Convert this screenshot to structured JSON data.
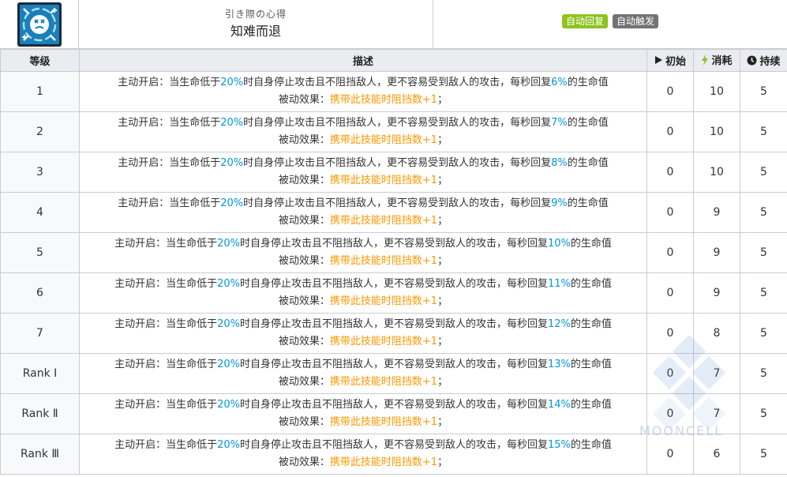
{
  "skill": {
    "name_jp": "引き際の心得",
    "name_cn": "知难而退",
    "icon": "skill-icon-broken-shield",
    "tags": [
      {
        "label": "自动回复",
        "color": "#8ec31f"
      },
      {
        "label": "自动触发",
        "color": "#737373"
      }
    ]
  },
  "table": {
    "headers": {
      "level": "等级",
      "desc": "描述",
      "initial": "初始",
      "cost": "消耗",
      "duration": "持续"
    },
    "rows": [
      {
        "level": "1",
        "desc_a": "主动开启：当生命低于",
        "val1": "20%",
        "desc_b": "时自身停止攻击且不阻挡敌人，更不容易受到敌人的攻击，每秒回复",
        "val2": "6%",
        "desc_c": "的生命值",
        "passive_label": "被动效果：",
        "passive": "携带此技能时阻挡数+1",
        "passive_end": "；",
        "initial": "0",
        "cost": "10",
        "duration": "5"
      },
      {
        "level": "2",
        "desc_a": "主动开启：当生命低于",
        "val1": "20%",
        "desc_b": "时自身停止攻击且不阻挡敌人，更不容易受到敌人的攻击，每秒回复",
        "val2": "7%",
        "desc_c": "的生命值",
        "passive_label": "被动效果：",
        "passive": "携带此技能时阻挡数+1",
        "passive_end": "；",
        "initial": "0",
        "cost": "10",
        "duration": "5"
      },
      {
        "level": "3",
        "desc_a": "主动开启：当生命低于",
        "val1": "20%",
        "desc_b": "时自身停止攻击且不阻挡敌人，更不容易受到敌人的攻击，每秒回复",
        "val2": "8%",
        "desc_c": "的生命值",
        "passive_label": "被动效果：",
        "passive": "携带此技能时阻挡数+1",
        "passive_end": "；",
        "initial": "0",
        "cost": "10",
        "duration": "5"
      },
      {
        "level": "4",
        "desc_a": "主动开启：当生命低于",
        "val1": "20%",
        "desc_b": "时自身停止攻击且不阻挡敌人，更不容易受到敌人的攻击，每秒回复",
        "val2": "9%",
        "desc_c": "的生命值",
        "passive_label": "被动效果：",
        "passive": "携带此技能时阻挡数+1",
        "passive_end": "；",
        "initial": "0",
        "cost": "9",
        "duration": "5"
      },
      {
        "level": "5",
        "desc_a": "主动开启：当生命低于",
        "val1": "20%",
        "desc_b": "时自身停止攻击且不阻挡敌人，更不容易受到敌人的攻击，每秒回复",
        "val2": "10%",
        "desc_c": "的生命值",
        "passive_label": "被动效果：",
        "passive": "携带此技能时阻挡数+1",
        "passive_end": "；",
        "initial": "0",
        "cost": "9",
        "duration": "5"
      },
      {
        "level": "6",
        "desc_a": "主动开启：当生命低于",
        "val1": "20%",
        "desc_b": "时自身停止攻击且不阻挡敌人，更不容易受到敌人的攻击，每秒回复",
        "val2": "11%",
        "desc_c": "的生命值",
        "passive_label": "被动效果：",
        "passive": "携带此技能时阻挡数+1",
        "passive_end": "；",
        "initial": "0",
        "cost": "9",
        "duration": "5"
      },
      {
        "level": "7",
        "desc_a": "主动开启：当生命低于",
        "val1": "20%",
        "desc_b": "时自身停止攻击且不阻挡敌人，更不容易受到敌人的攻击，每秒回复",
        "val2": "12%",
        "desc_c": "的生命值",
        "passive_label": "被动效果：",
        "passive": "携带此技能时阻挡数+1",
        "passive_end": "；",
        "initial": "0",
        "cost": "8",
        "duration": "5"
      },
      {
        "level": "Rank Ⅰ",
        "desc_a": "主动开启：当生命低于",
        "val1": "20%",
        "desc_b": "时自身停止攻击且不阻挡敌人，更不容易受到敌人的攻击，每秒回复",
        "val2": "13%",
        "desc_c": "的生命值",
        "passive_label": "被动效果：",
        "passive": "携带此技能时阻挡数+1",
        "passive_end": "；",
        "initial": "0",
        "cost": "7",
        "duration": "5"
      },
      {
        "level": "Rank Ⅱ",
        "desc_a": "主动开启：当生命低于",
        "val1": "20%",
        "desc_b": "时自身停止攻击且不阻挡敌人，更不容易受到敌人的攻击，每秒回复",
        "val2": "14%",
        "desc_c": "的生命值",
        "passive_label": "被动效果：",
        "passive": "携带此技能时阻挡数+1",
        "passive_end": "；",
        "initial": "0",
        "cost": "7",
        "duration": "5"
      },
      {
        "level": "Rank Ⅲ",
        "desc_a": "主动开启：当生命低于",
        "val1": "20%",
        "desc_b": "时自身停止攻击且不阻挡敌人，更不容易受到敌人的攻击，每秒回复",
        "val2": "15%",
        "desc_c": "的生命值",
        "passive_label": "被动效果：",
        "passive": "携带此技能时阻挡数+1",
        "passive_end": "；",
        "initial": "0",
        "cost": "6",
        "duration": "5"
      }
    ]
  },
  "watermark": {
    "text": "MOONCELL"
  },
  "colors": {
    "highlight_value": "#0098dc",
    "highlight_passive": "#ff9800",
    "sp_icon": "#8ec31f",
    "header_bg": "#eaecf0"
  }
}
